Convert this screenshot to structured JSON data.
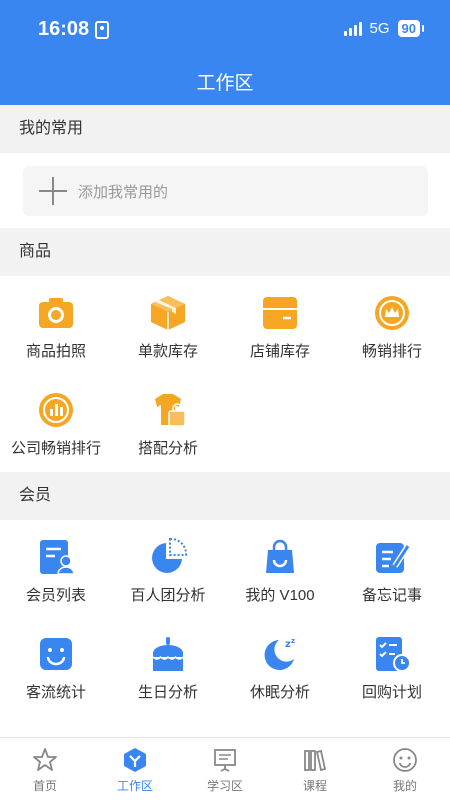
{
  "status_bar": {
    "time": "16:08",
    "network": "5G",
    "battery": "90"
  },
  "header": {
    "title": "工作区"
  },
  "sections": {
    "favorites": {
      "title": "我的常用",
      "add_label": "添加我常用的"
    },
    "goods": {
      "title": "商品",
      "items": [
        "商品拍照",
        "单款库存",
        "店铺库存",
        "畅销排行",
        "公司畅销排行",
        "搭配分析"
      ]
    },
    "members": {
      "title": "会员",
      "items": [
        "会员列表",
        "百人团分析",
        "我的 V100",
        "备忘记事",
        "客流统计",
        "生日分析",
        "休眠分析",
        "回购计划"
      ]
    }
  },
  "tabbar": {
    "items": [
      {
        "label": "首页",
        "icon": "star-home-icon"
      },
      {
        "label": "工作区",
        "icon": "workspace-icon",
        "active": true
      },
      {
        "label": "学习区",
        "icon": "presentation-icon"
      },
      {
        "label": "课程",
        "icon": "books-icon"
      },
      {
        "label": "我的",
        "icon": "smile-icon"
      }
    ]
  },
  "colors": {
    "primary": "#3a86f0",
    "orange": "#f5a623",
    "gray_bg": "#f2f2f2"
  }
}
